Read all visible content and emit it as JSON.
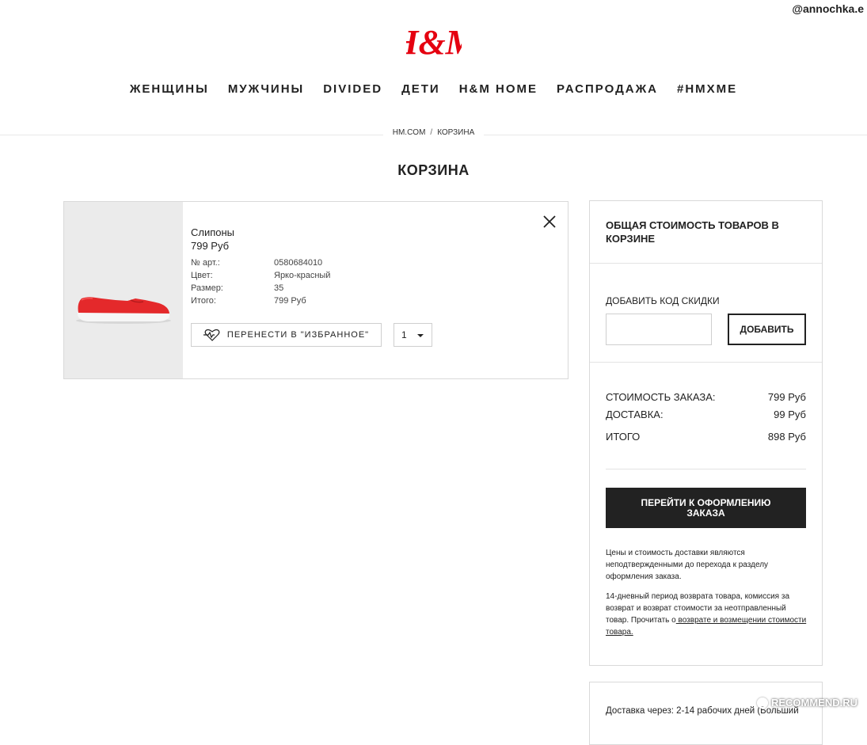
{
  "watermark_top": "@annochka.e",
  "brand": {
    "logo_text": "H&M",
    "color": "#e50010"
  },
  "nav": [
    "ЖЕНЩИНЫ",
    "МУЖЧИНЫ",
    "DIVIDED",
    "ДЕТИ",
    "H&M HOME",
    "РАСПРОДАЖА",
    "#HMXME"
  ],
  "breadcrumb": {
    "home": "HM.COM",
    "separator": "/",
    "current": "КОРЗИНА"
  },
  "page_title": "КОРЗИНА",
  "item": {
    "name": "Слипоны",
    "price": "799 Руб",
    "details": [
      {
        "label": "№ арт.:",
        "value": "0580684010"
      },
      {
        "label": "Цвет:",
        "value": "Ярко-красный"
      },
      {
        "label": "Размер:",
        "value": "35"
      },
      {
        "label": "Итого:",
        "value": "799 Руб"
      }
    ],
    "move_to_fav_label": "ПЕРЕНЕСТИ В \"ИЗБРАННОЕ\"",
    "quantity": "1",
    "shoe_color": "#e4292b"
  },
  "summary": {
    "title": "ОБЩАЯ СТОИМОСТЬ ТОВАРОВ В КОРЗИНЕ",
    "discount_label": "ДОБАВИТЬ КОД СКИДКИ",
    "discount_placeholder": "",
    "discount_button": "ДОБАВИТЬ",
    "order_cost_label": "СТОИМОСТЬ ЗАКАЗА:",
    "order_cost_value": "799 Руб",
    "delivery_label": "ДОСТАВКА:",
    "delivery_value": "99 Руб",
    "total_label": "ИТОГО",
    "total_value": "898 Руб",
    "checkout_button": "ПЕРЕЙТИ К ОФОРМЛЕНИЮ ЗАКАЗА",
    "note1": "Цены и стоимость доставки являются неподтвержденными до перехода к разделу оформления заказа.",
    "note2_text": "14-дневный период возврата товара, комиссия за возврат и возврат стоимости за неотправленный товар. Прочитать о",
    "note2_link": " возврате и возмещении стоимости товара."
  },
  "delivery_info": "Доставка через: 2-14 рабочих дней (Больший",
  "watermark_bottom": "RECOMMEND.RU"
}
